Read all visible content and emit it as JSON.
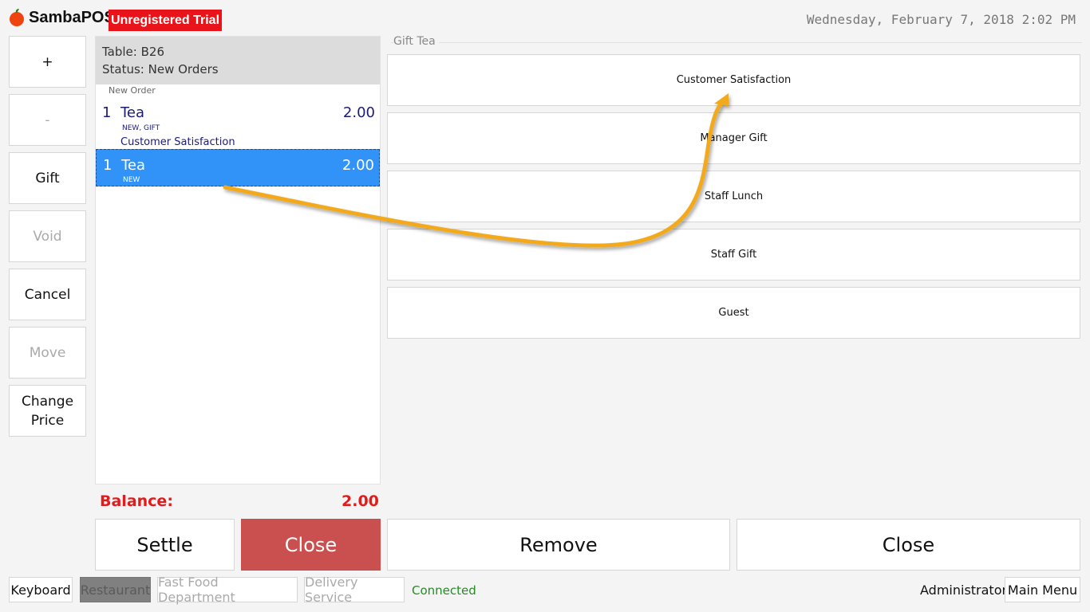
{
  "header": {
    "app_name": "SambaPOS",
    "trial_badge": "Unregistered Trial",
    "datetime": "Wednesday, February 7, 2018 2:02 PM"
  },
  "commands": {
    "plus": "+",
    "minus": "-",
    "gift": "Gift",
    "void": "Void",
    "cancel": "Cancel",
    "move": "Move",
    "change_price_1": "Change",
    "change_price_2": "Price"
  },
  "ticket": {
    "table": "Table: B26",
    "status": "Status: New Orders",
    "group": "New Order",
    "orders": [
      {
        "qty": "1",
        "name": "Tea",
        "price": "2.00",
        "tags": "NEW, GIFT",
        "sub": "Customer Satisfaction"
      },
      {
        "qty": "1",
        "name": "Tea",
        "price": "2.00",
        "tags": "NEW"
      }
    ],
    "balance_label": "Balance:",
    "balance_value": "2.00"
  },
  "actions": {
    "settle": "Settle",
    "close_ticket": "Close",
    "remove": "Remove",
    "close": "Close"
  },
  "gift_panel": {
    "title": "Gift Tea",
    "reasons": [
      "Customer Satisfaction",
      "Manager Gift",
      "Staff Lunch",
      "Staff Gift",
      "Guest"
    ]
  },
  "footer": {
    "keyboard": "Keyboard",
    "restaurant": "Restaurant",
    "fast_food": "Fast Food Department",
    "delivery": "Delivery Service",
    "connection": "Connected",
    "user": "Administrator",
    "main_menu": "Main Menu"
  },
  "colors": {
    "accent_red": "#e8141a",
    "close_red": "#c9504f",
    "selected_blue": "#3193f7",
    "arrow_orange": "#f2a91d",
    "connected_green": "#238c23"
  }
}
